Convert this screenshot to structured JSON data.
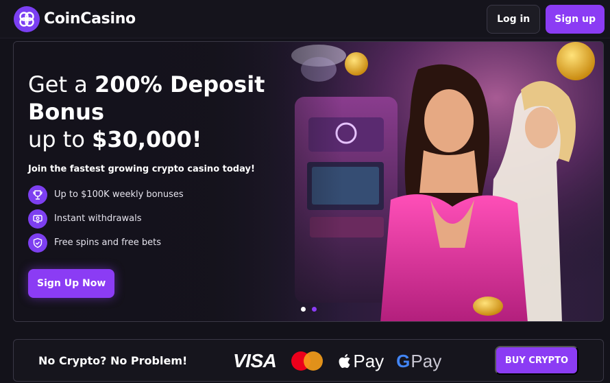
{
  "header": {
    "brand": "CoinCasino",
    "login_label": "Log in",
    "signup_label": "Sign up"
  },
  "hero": {
    "headline_line1_prefix": "Get a ",
    "headline_line1_bold": "200% Deposit",
    "headline_line2_bold": "Bonus",
    "headline_line3_prefix": "up to ",
    "headline_line3_bold": "$30,000!",
    "subheadline": "Join the fastest growing crypto casino today!",
    "features": [
      {
        "icon": "trophy-icon",
        "label": "Up to $100K weekly bonuses"
      },
      {
        "icon": "withdraw-icon",
        "label": "Instant withdrawals"
      },
      {
        "icon": "shield-check-icon",
        "label": "Free spins and free bets"
      }
    ],
    "cta_label": "Sign Up Now",
    "carousel": {
      "slides": 2,
      "active_index": 1
    }
  },
  "payments": {
    "text": "No Crypto? No Problem!",
    "visa_label": "VISA",
    "applepay_label": "Pay",
    "gpay_label": "Pay",
    "buy_label": "BUY CRYPTO"
  },
  "colors": {
    "accent": "#8b3cf4",
    "background": "#13121a",
    "border": "#3a3846"
  }
}
